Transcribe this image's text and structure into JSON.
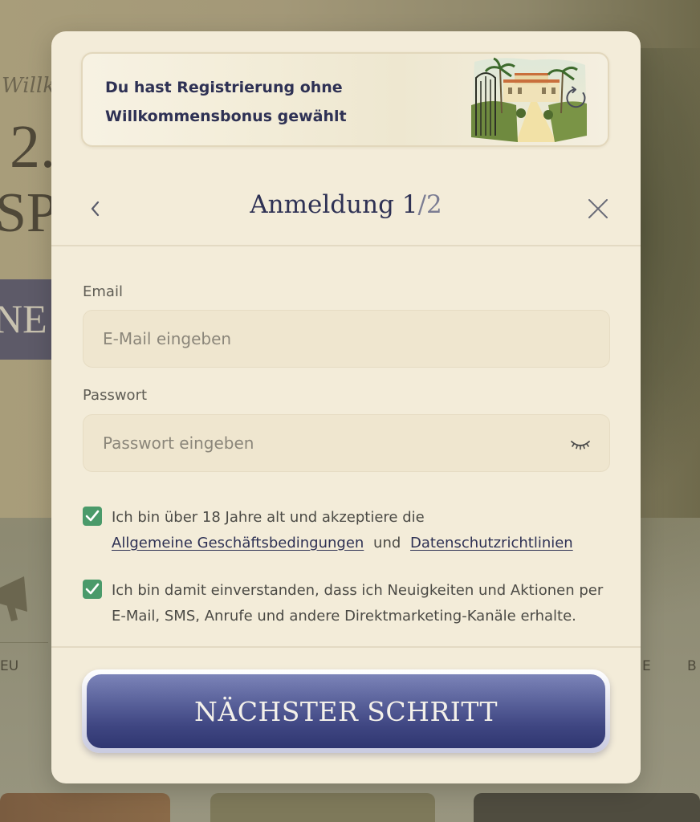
{
  "background": {
    "promo_small": "Willkommenspaket",
    "promo_big": "2.",
    "promo_big2": "SPI",
    "button_text": "NE",
    "nav_left": "EU",
    "nav_right_1": "E",
    "nav_right_2": "B"
  },
  "modal": {
    "bonus_banner": {
      "line1": "Du hast Registrierung ohne",
      "line2": "Willkommensbonus gewählt"
    },
    "header": {
      "title": "Anmeldung",
      "step_current": "1",
      "step_separator": "/",
      "step_total": "2"
    },
    "email": {
      "label": "Email",
      "placeholder": "E-Mail eingeben",
      "value": ""
    },
    "password": {
      "label": "Passwort",
      "placeholder": "Passwort eingeben",
      "value": ""
    },
    "consent_terms": {
      "checked": true,
      "text": "Ich bin über 18 Jahre alt und akzeptiere die",
      "link_terms": "Allgemeine Geschäftsbedingungen",
      "and": "und",
      "link_privacy": "Datenschutzrichtlinien"
    },
    "consent_marketing": {
      "checked": true,
      "line1": "Ich bin damit einverstanden, dass ich Neuigkeiten und Aktionen per",
      "line2": "E-Mail, SMS, Anrufe und andere Direktmarketing-Kanäle erhalte."
    },
    "next_button": {
      "label": "NÄCHSTER SCHRITT"
    }
  },
  "colors": {
    "modal_bg": "#f3ecd9",
    "title_text": "#2e3154",
    "checkbox_green": "#4a9a6a",
    "button_blue": "#3f4682"
  },
  "icons": {
    "back": "chevron-left-icon",
    "close": "close-icon",
    "refresh": "refresh-icon",
    "eye": "eye-closed-icon",
    "check": "checkmark-icon"
  }
}
